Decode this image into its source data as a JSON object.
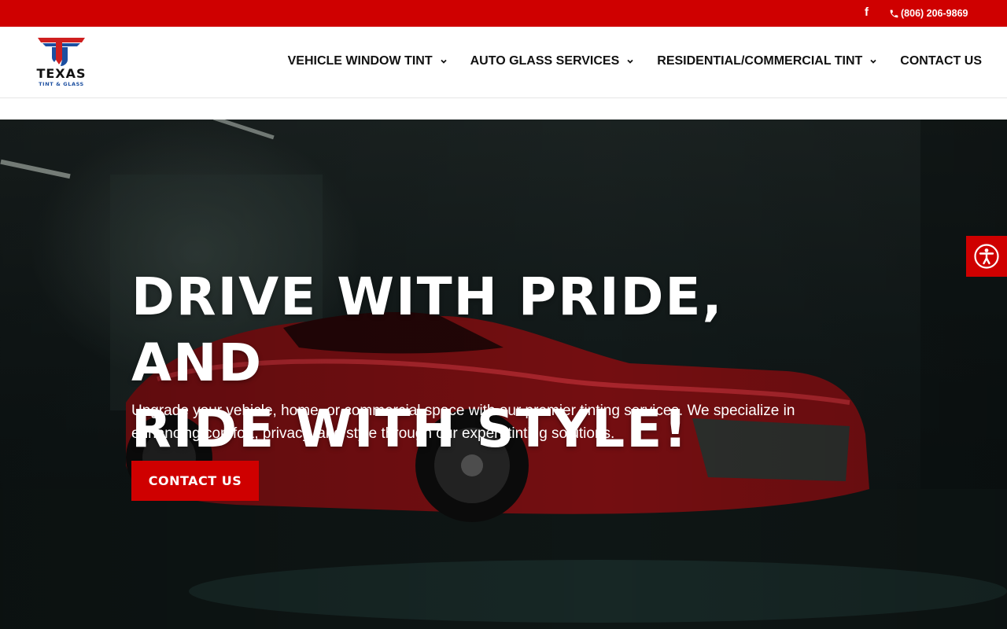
{
  "topbar": {
    "facebook_icon": "facebook-icon",
    "phone_icon": "phone-icon",
    "phone": "(806) 206-9869",
    "background": "#cf0000"
  },
  "header": {
    "logo": {
      "wordmark": "TEXAS",
      "tagline": "TINT & GLASS"
    },
    "nav": [
      {
        "label": "VEHICLE WINDOW TINT",
        "has_dropdown": true
      },
      {
        "label": "AUTO GLASS SERVICES",
        "has_dropdown": true
      },
      {
        "label": "RESIDENTIAL/COMMERCIAL TINT",
        "has_dropdown": true
      },
      {
        "label": "CONTACT US",
        "has_dropdown": false
      }
    ]
  },
  "hero": {
    "headline_line1": "DRIVE WITH PRIDE, AND",
    "headline_line2": "RIDE WITH STYLE!",
    "description": "Upgrade your vehicle, home, or commercial space with our premier tinting services. We specialize in enhancing comfort, privacy, and style through our expert tinting solutions.",
    "cta_label": "CONTACT US",
    "background_image": "red sports car in dark garage"
  },
  "accessibility": {
    "icon": "accessibility-icon",
    "color": "#cf0000"
  }
}
